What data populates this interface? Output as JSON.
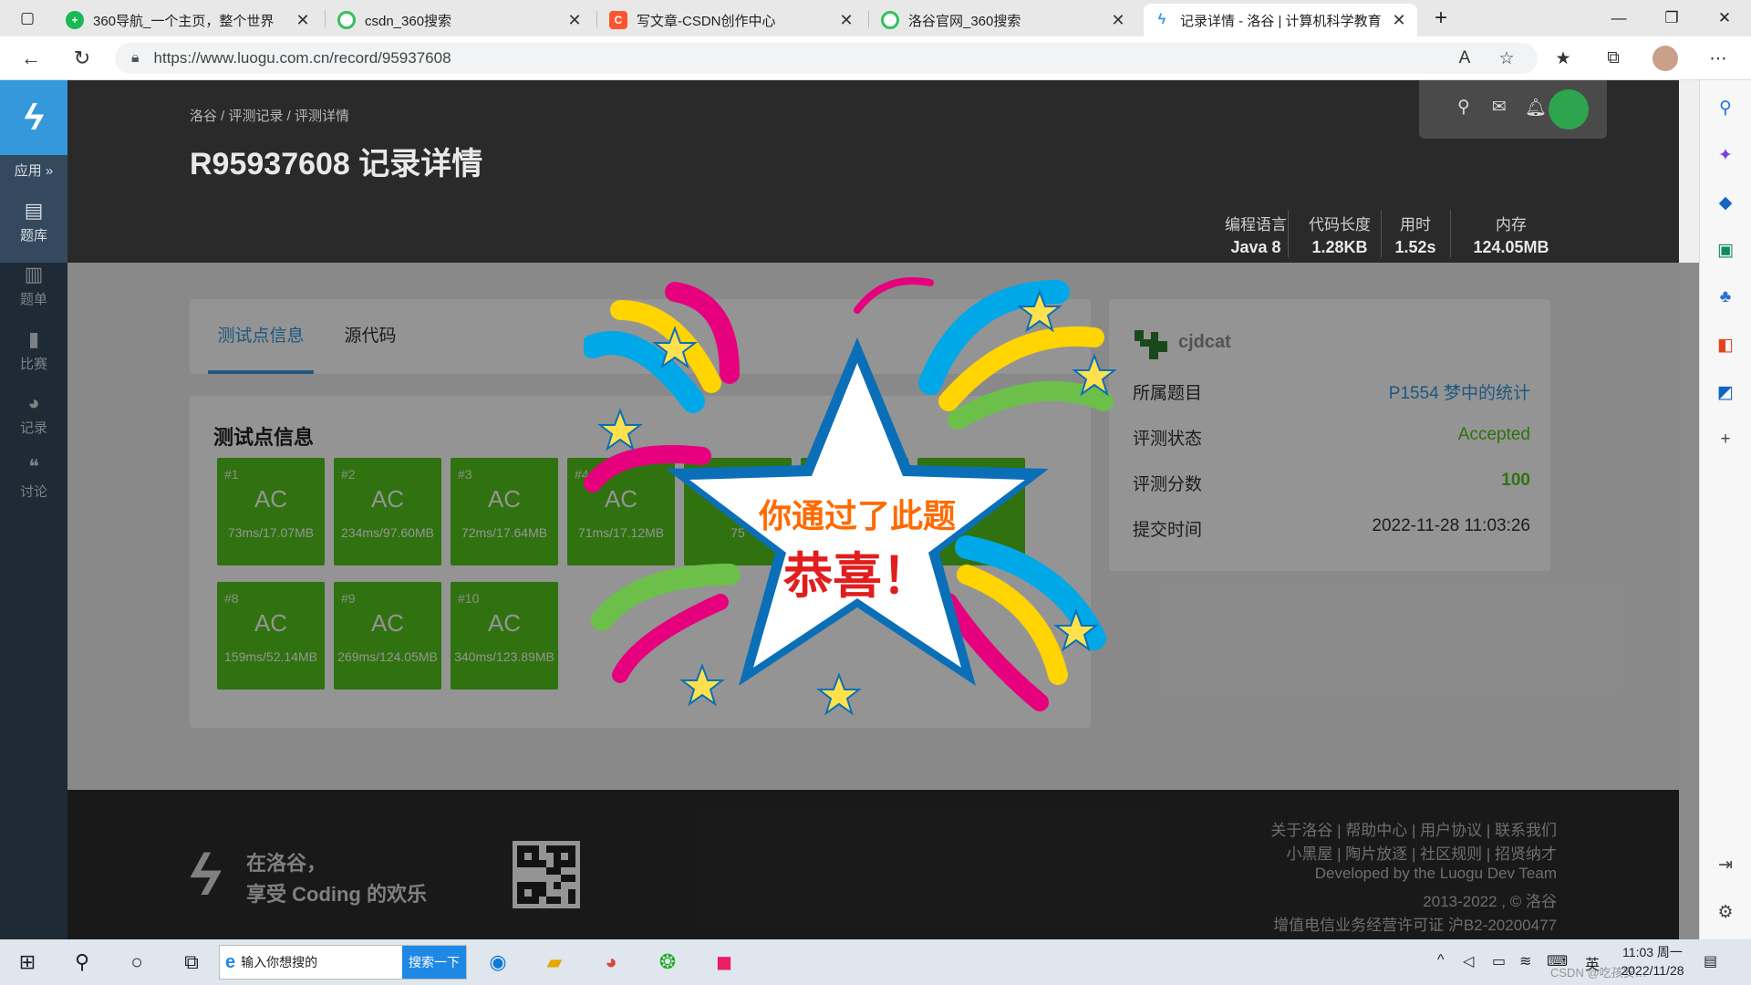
{
  "browser": {
    "tabs": [
      {
        "title": "360导航_一个主页，整个世界",
        "icon": "360-icon",
        "color": "#19b955"
      },
      {
        "title": "csdn_360搜索",
        "icon": "360search-icon",
        "color": "#33c25a"
      },
      {
        "title": "写文章-CSDN创作中心",
        "icon": "csdn-icon",
        "color": "#fc5531"
      },
      {
        "title": "洛谷官网_360搜索",
        "icon": "360search-icon",
        "color": "#33c25a"
      },
      {
        "title": "记录详情 - 洛谷 | 计算机科学教育",
        "icon": "luogu-icon",
        "color": "#3498db",
        "active": true
      }
    ],
    "url": "https://www.luogu.com.cn/record/95937608"
  },
  "nav": {
    "apps_label": "应用 »",
    "items": [
      {
        "label": "题库",
        "icon": "book-icon"
      },
      {
        "label": "题单",
        "icon": "clipboard-icon"
      },
      {
        "label": "比赛",
        "icon": "bar-chart-icon"
      },
      {
        "label": "记录",
        "icon": "pie-chart-icon"
      },
      {
        "label": "讨论",
        "icon": "chat-icon"
      }
    ]
  },
  "header": {
    "breadcrumb": "洛谷 / 评测记录 / 评测详情",
    "title": "R95937608 记录详情",
    "stats": [
      {
        "label": "编程语言",
        "value": "Java 8"
      },
      {
        "label": "代码长度",
        "value": "1.28KB"
      },
      {
        "label": "用时",
        "value": "1.52s"
      },
      {
        "label": "内存",
        "value": "124.05MB"
      }
    ]
  },
  "tabs": [
    {
      "label": "测试点信息",
      "active": true
    },
    {
      "label": "源代码",
      "active": false
    }
  ],
  "testcases": {
    "title": "测试点信息",
    "cases": [
      {
        "id": "#1",
        "result": "AC",
        "info": "73ms/17.07MB"
      },
      {
        "id": "#2",
        "result": "AC",
        "info": "234ms/97.60MB"
      },
      {
        "id": "#3",
        "result": "AC",
        "info": "72ms/17.64MB"
      },
      {
        "id": "#4",
        "result": "AC",
        "info": "71ms/17.12MB"
      },
      {
        "id": "#5",
        "result": "AC",
        "info": "75"
      },
      {
        "id": "#8",
        "result": "AC",
        "info": "159ms/52.14MB"
      },
      {
        "id": "#9",
        "result": "AC",
        "info": "269ms/124.05MB"
      },
      {
        "id": "#10",
        "result": "AC",
        "info": "340ms/123.89MB"
      }
    ]
  },
  "info": {
    "username": "cjdcat",
    "rows": [
      {
        "key": "所属题目",
        "value": "P1554 梦中的统计",
        "color": "#3498db"
      },
      {
        "key": "评测状态",
        "value": "Accepted",
        "color": "#52c41a"
      },
      {
        "key": "评测分数",
        "value": "100",
        "color": "#52c41a"
      },
      {
        "key": "提交时间",
        "value": "2022-11-28 11:03:26",
        "color": "#333333"
      }
    ]
  },
  "overlay": {
    "line1": "你通过了此题",
    "line2": "恭喜！"
  },
  "footer": {
    "slogan1": "在洛谷，",
    "slogan2": "享受 Coding 的欢乐",
    "links1": "关于洛谷 | 帮助中心 | 用户协议 | 联系我们",
    "links2": "小黑屋 | 陶片放逐 | 社区规则 | 招贤纳才",
    "dev": "Developed by the Luogu Dev Team",
    "copyright": "2013-2022 , © 洛谷",
    "license": "增值电信业务经营许可证 沪B2-20200477"
  },
  "taskbar": {
    "search_placeholder": "输入你想搜的",
    "search_button": "搜索一下",
    "ime": "英",
    "time": "11:03 周一",
    "date": "2022/11/28",
    "watermark": "CSDN @吃孩安…"
  }
}
